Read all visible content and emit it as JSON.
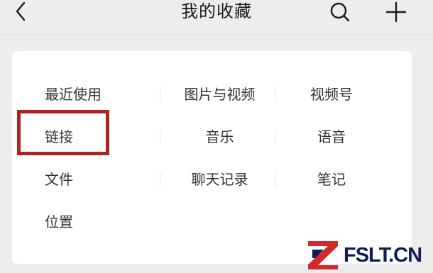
{
  "header": {
    "title": "我的收藏",
    "back_icon": "chevron-left-icon",
    "search_icon": "search-icon",
    "add_icon": "plus-icon"
  },
  "categories": [
    {
      "label": "最近使用"
    },
    {
      "label": "图片与视频"
    },
    {
      "label": "视频号"
    },
    {
      "label": "链接",
      "highlighted": true
    },
    {
      "label": "音乐"
    },
    {
      "label": "语音"
    },
    {
      "label": "文件"
    },
    {
      "label": "聊天记录"
    },
    {
      "label": "笔记"
    },
    {
      "label": "位置"
    }
  ],
  "watermark": {
    "text": "FSLT.CN",
    "logo_icon": "z-logo-icon"
  },
  "colors": {
    "background": "#ededed",
    "panel": "#ffffff",
    "highlight_border": "#b22020",
    "watermark_text": "#0e1d5a",
    "watermark_logo": "#d62a2a"
  }
}
